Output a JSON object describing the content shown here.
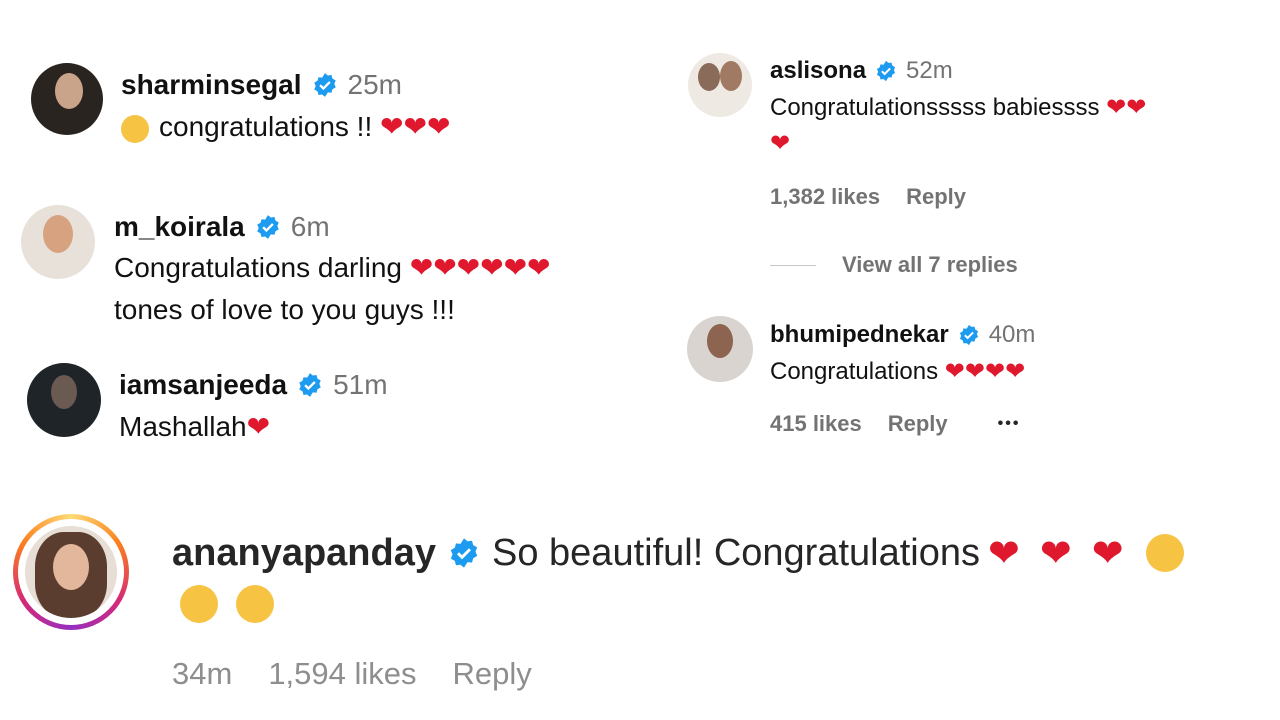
{
  "comments": {
    "c1": {
      "username": "sharminsegal",
      "time": "25m",
      "text": "congratulations !! ",
      "hearts": "❤❤❤"
    },
    "c2": {
      "username": "m_koirala",
      "time": "6m",
      "text1": "Congratulations darling ",
      "hearts": "❤❤❤❤❤❤",
      "text2": "tones of love to you guys !!!"
    },
    "c3": {
      "username": "iamsanjeeda",
      "time": "51m",
      "text": "Mashallah",
      "hearts": "❤"
    },
    "c4": {
      "username": "aslisona",
      "time": "52m",
      "text": "Congratulationsssss babiessss ",
      "hearts": "❤❤",
      "hearts2": "❤",
      "likes": "1,382 likes",
      "reply": "Reply",
      "view_replies": "View all 7 replies"
    },
    "c5": {
      "username": "bhumipednekar",
      "time": "40m",
      "text": "Congratulations ",
      "hearts": "❤❤❤❤",
      "likes": "415 likes",
      "reply": "Reply",
      "more": "•••"
    },
    "c6": {
      "username": "ananyapanday",
      "text": "So beautiful! Congratulations ",
      "hearts": "❤",
      "time": "34m",
      "likes": "1,594 likes",
      "reply": "Reply"
    }
  },
  "colors": {
    "verified": "#1d9bf0",
    "heart": "#e0182d",
    "muted": "#737373"
  },
  "icons": [
    "verified-badge-icon",
    "heart-emoji",
    "pleading-face-emoji",
    "partying-face-emoji",
    "more-dots-icon"
  ]
}
